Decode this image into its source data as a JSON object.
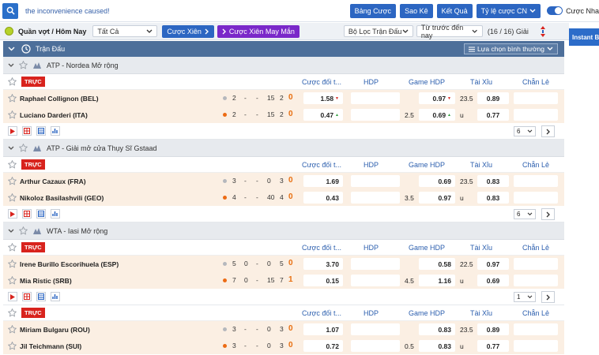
{
  "topbar": {
    "search_text": "the inconvenience caused!",
    "btn_bang_cuoc": "Bảng Cược",
    "btn_sao_ke": "Sao Kê",
    "btn_ket_qua": "Kết Quả",
    "btn_ty_le": "Tỷ lệ cược CN",
    "toggle_label": "Cược Nha"
  },
  "filterbar": {
    "sport_label": "Quần vợt / Hôm Nay",
    "select_all": "Tất Cả",
    "cuoc_xien": "Cược Xiên",
    "cuoc_xien_may_man": "Cược Xiên May Mắn",
    "league_filter": "Bộ Lọc Trận Đấu",
    "sort_time": "Từ trước đến nay",
    "page_count": "(16 / 16) Giải",
    "instant": "Instant Bet"
  },
  "header": {
    "title": "Trận Đấu",
    "sort_label": "Lựa chọn bình thường"
  },
  "columns": {
    "c1": "Cược đối t...",
    "c2": "HDP",
    "c3": "Game HDP",
    "c4": "Tài Xỉu",
    "c5": "Chẵn Lẻ"
  },
  "live_label": "TRỰC",
  "leagues": [
    {
      "name": "ATP - Nordea Mở rộng",
      "pager": "6",
      "teams": [
        {
          "name": "Raphael Collignon (BEL)",
          "s1": "2",
          "s2": "-",
          "s3": "-",
          "s4": "15",
          "s5": "2",
          "big": "0",
          "ml": "1.58",
          "ml_arrow": "▼",
          "hdp": "",
          "ghdp_line": "",
          "ghdp": "0.97",
          "ghdp_arrow": "▼",
          "ou_line": "23.5",
          "ou": "0.89"
        },
        {
          "name": "Luciano Darderi (ITA)",
          "s1": "2",
          "s2": "-",
          "s3": "-",
          "s4": "15",
          "s5": "2",
          "big": "0",
          "ml": "0.47",
          "ml_arrow": "▲",
          "hdp": "",
          "ghdp_line": "2.5",
          "ghdp": "0.69",
          "ghdp_arrow": "▲",
          "ou_line": "u",
          "ou": "0.77"
        }
      ]
    },
    {
      "name": "ATP - Giải mở cửa Thụy Sĩ Gstaad",
      "pager": "6",
      "teams": [
        {
          "name": "Arthur Cazaux (FRA)",
          "s1": "3",
          "s2": "-",
          "s3": "-",
          "s4": "0",
          "s5": "3",
          "big": "0",
          "ml": "1.69",
          "ml_arrow": "",
          "hdp": "",
          "ghdp_line": "",
          "ghdp": "0.69",
          "ghdp_arrow": "",
          "ou_line": "23.5",
          "ou": "0.83"
        },
        {
          "name": "Nikoloz Basilashvili (GEO)",
          "s1": "4",
          "s2": "-",
          "s3": "-",
          "s4": "40",
          "s5": "4",
          "big": "0",
          "ml": "0.43",
          "ml_arrow": "",
          "hdp": "",
          "ghdp_line": "3.5",
          "ghdp": "0.97",
          "ghdp_arrow": "",
          "ou_line": "u",
          "ou": "0.83"
        }
      ]
    },
    {
      "name": "WTA - Iasi Mở rộng",
      "pager": "1",
      "teams": [
        {
          "name": "Irene Burillo Escorihuela (ESP)",
          "s1": "5",
          "s2": "0",
          "s3": "-",
          "s4": "0",
          "s5": "5",
          "big": "0",
          "ml": "3.70",
          "ml_arrow": "",
          "hdp": "",
          "ghdp_line": "",
          "ghdp": "0.58",
          "ghdp_arrow": "",
          "ou_line": "22.5",
          "ou": "0.97"
        },
        {
          "name": "Mia Ristic (SRB)",
          "s1": "7",
          "s2": "0",
          "s3": "-",
          "s4": "15",
          "s5": "7",
          "big": "1",
          "ml": "0.15",
          "ml_arrow": "",
          "hdp": "",
          "ghdp_line": "4.5",
          "ghdp": "1.16",
          "ghdp_arrow": "",
          "ou_line": "u",
          "ou": "0.69"
        }
      ]
    },
    {
      "name": "",
      "pager": "",
      "teams": [
        {
          "name": "Miriam Bulgaru (ROU)",
          "s1": "3",
          "s2": "-",
          "s3": "-",
          "s4": "0",
          "s5": "3",
          "big": "0",
          "ml": "1.07",
          "ml_arrow": "",
          "hdp": "",
          "ghdp_line": "",
          "ghdp": "0.83",
          "ghdp_arrow": "",
          "ou_line": "23.5",
          "ou": "0.89"
        },
        {
          "name": "Jil Teichmann (SUI)",
          "s1": "3",
          "s2": "-",
          "s3": "-",
          "s4": "0",
          "s5": "3",
          "big": "0",
          "ml": "0.72",
          "ml_arrow": "",
          "hdp": "",
          "ghdp_line": "0.5",
          "ghdp": "0.83",
          "ghdp_arrow": "",
          "ou_line": "u",
          "ou": "0.77"
        }
      ]
    }
  ]
}
